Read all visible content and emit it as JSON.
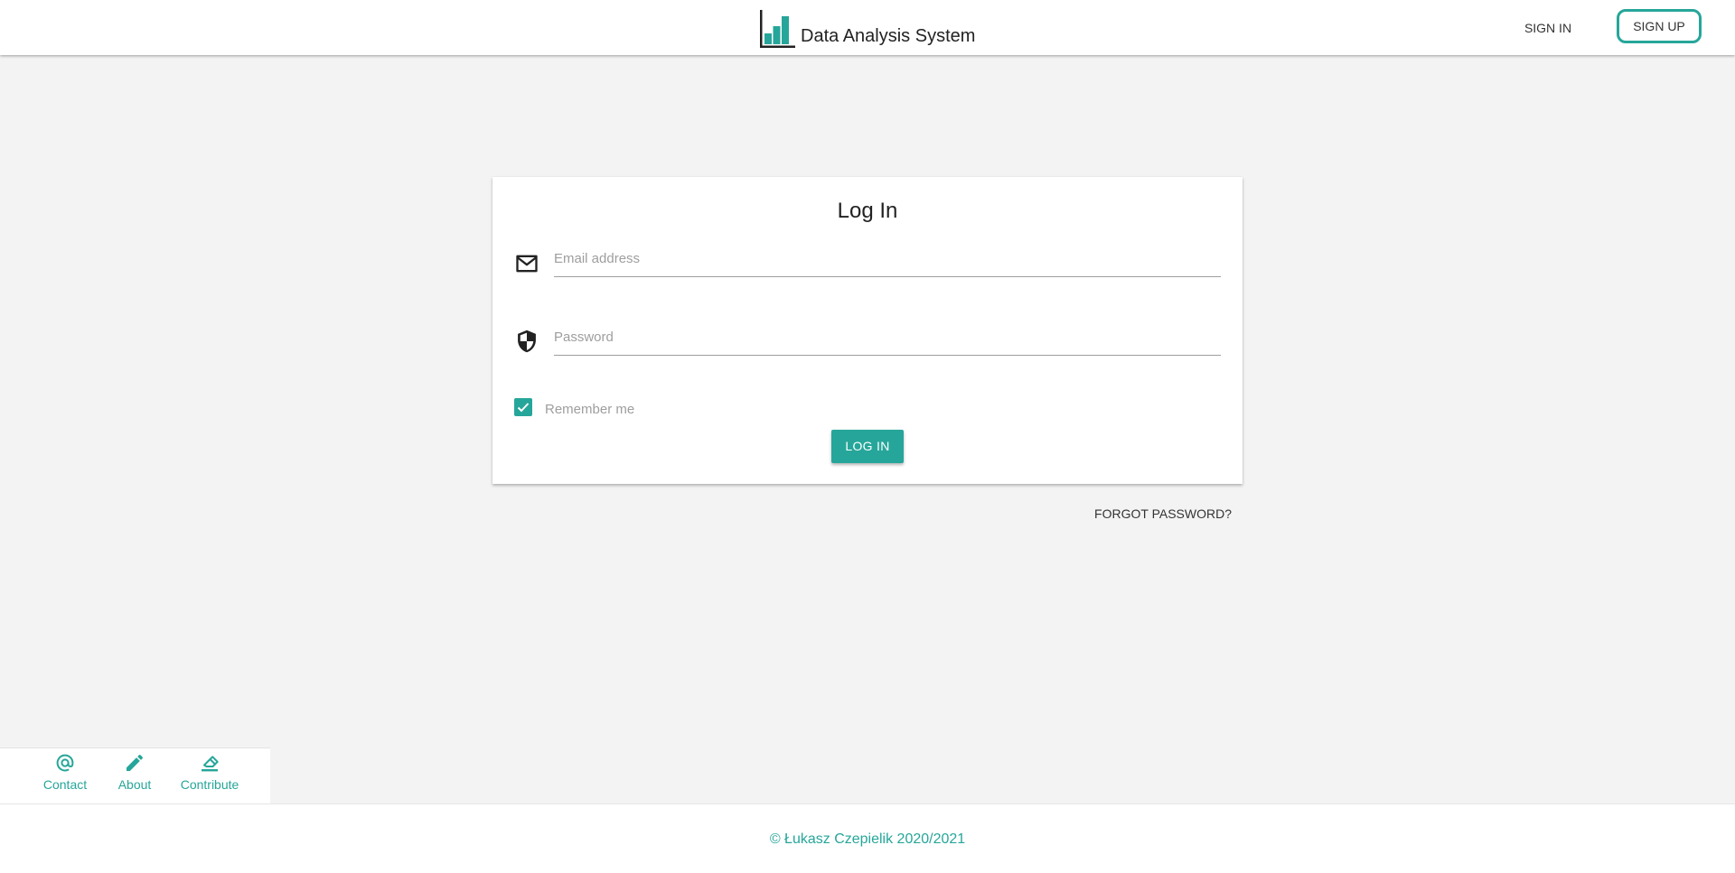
{
  "header": {
    "app_title": "Data Analysis System",
    "nav": {
      "sign_in": "SIGN IN",
      "sign_up": "SIGN UP"
    }
  },
  "login": {
    "title": "Log In",
    "email": {
      "placeholder": "Email address",
      "value": "",
      "icon": "mail-icon"
    },
    "password": {
      "placeholder": "Password",
      "value": "",
      "icon": "shield-icon"
    },
    "remember_me": {
      "label": "Remember me",
      "checked": true
    },
    "submit_label": "LOG IN",
    "forgot_password": "FORGOT PASSWORD?"
  },
  "footer": {
    "links": [
      {
        "label": "Contact",
        "icon": "at-sign-icon"
      },
      {
        "label": "About",
        "icon": "pencil-icon"
      },
      {
        "label": "Contribute",
        "icon": "eraser-icon"
      }
    ],
    "copyright": "© Łukasz Czepielik 2020/2021"
  },
  "colors": {
    "accent": "#26a69a",
    "background": "#f3f3f3",
    "surface": "#ffffff"
  }
}
